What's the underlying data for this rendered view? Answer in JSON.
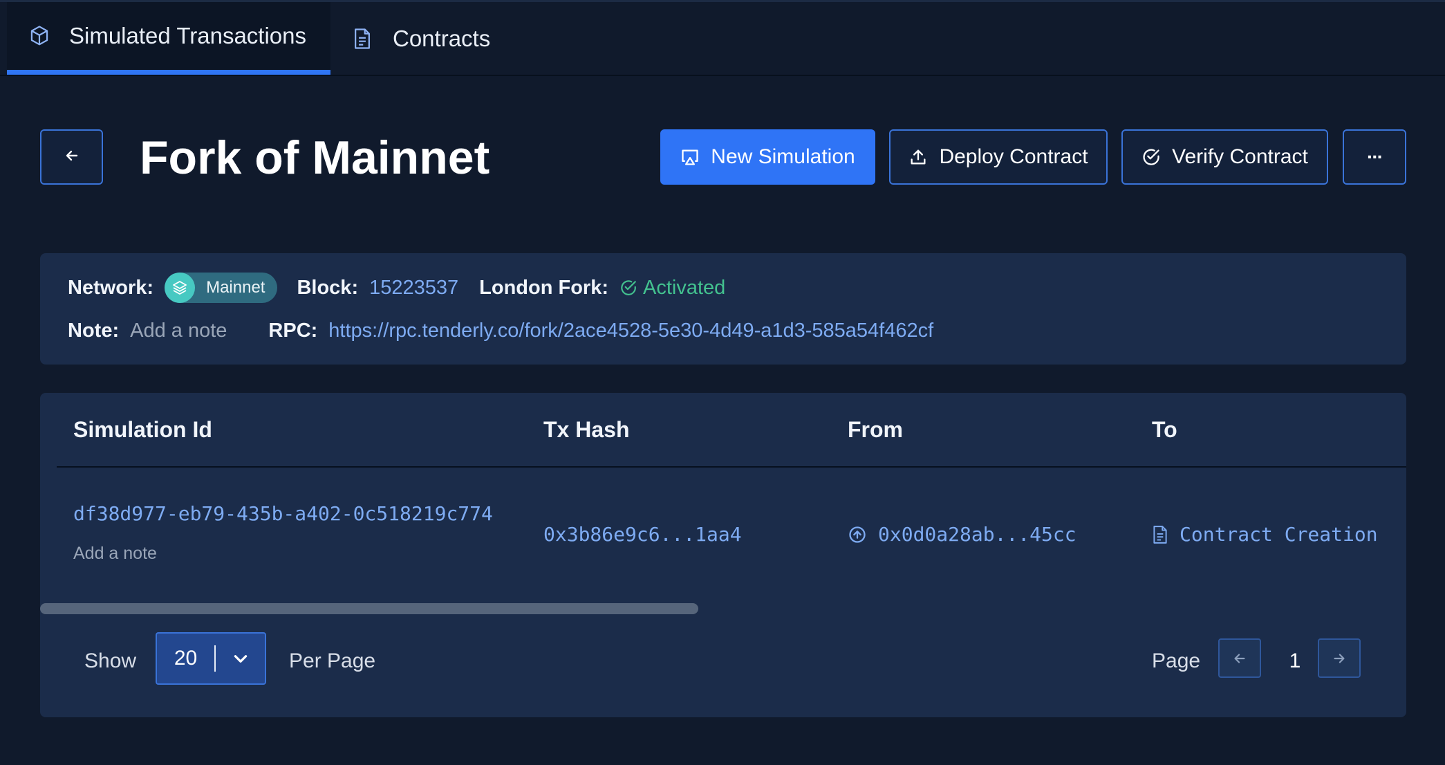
{
  "tabs": [
    {
      "label": "Simulated Transactions",
      "icon": "cube-icon",
      "active": true
    },
    {
      "label": "Contracts",
      "icon": "document-icon",
      "active": false
    }
  ],
  "header": {
    "title": "Fork of Mainnet",
    "buttons": {
      "new_simulation": "New Simulation",
      "deploy_contract": "Deploy Contract",
      "verify_contract": "Verify Contract",
      "more": "···"
    }
  },
  "info": {
    "network_label": "Network:",
    "network_value": "Mainnet",
    "block_label": "Block:",
    "block_value": "15223537",
    "london_fork_label": "London Fork:",
    "london_fork_value": "Activated",
    "note_label": "Note:",
    "note_value": "Add a note",
    "rpc_label": "RPC:",
    "rpc_value": "https://rpc.tenderly.co/fork/2ace4528-5e30-4d49-a1d3-585a54f462cf"
  },
  "table": {
    "columns": [
      "Simulation Id",
      "Tx Hash",
      "From",
      "To"
    ],
    "rows": [
      {
        "simulation_id": "df38d977-eb79-435b-a402-0c518219c774",
        "note": "Add a note",
        "tx_hash": "0x3b86e9c6...1aa4",
        "from": "0x0d0a28ab...45cc",
        "to": "Contract Creation"
      }
    ]
  },
  "pagination": {
    "show_label": "Show",
    "per_page_value": "20",
    "per_page_label": "Per Page",
    "page_label": "Page",
    "current_page": "1"
  },
  "colors": {
    "background": "#101a2c",
    "card": "#1b2c4a",
    "accent": "#2f74f6",
    "link": "#7eabf2",
    "success": "#43c28f"
  }
}
